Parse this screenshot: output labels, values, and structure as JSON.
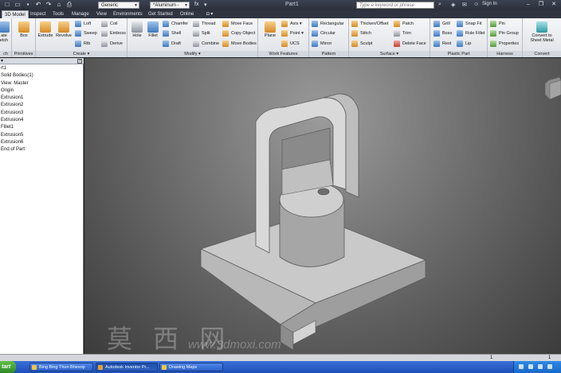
{
  "app": {
    "doc_title": "Part1",
    "help_search_placeholder": "Type a keyword or phrase",
    "sign_in": "Sign In",
    "qat_icons": [
      "new-icon",
      "open-icon",
      "save-icon",
      "undo-icon",
      "redo-icon",
      "home-icon",
      "print-icon"
    ],
    "appearance_combo": "Generic",
    "material_combo": "*Aluminum -"
  },
  "tabs": [
    {
      "label": "3D Model",
      "active": true
    },
    {
      "label": "Inspect"
    },
    {
      "label": "Tools"
    },
    {
      "label": "Manage"
    },
    {
      "label": "View"
    },
    {
      "label": "Environments"
    },
    {
      "label": "Get Started"
    },
    {
      "label": "Online"
    }
  ],
  "ribbon": {
    "panels": {
      "sketch": "ch",
      "primitives": "Primitives",
      "create": "Create",
      "modify": "Modify",
      "work_features": "Work Features",
      "pattern": "Pattern",
      "surface": "Surface",
      "plastic_part": "Plastic Part",
      "harness": "Harness",
      "convert": "Convert"
    },
    "buttons": {
      "sketch_partial": "ate\netch",
      "box": "Box",
      "extrude": "Extrude",
      "revolve": "Revolve",
      "loft": "Loft",
      "sweep": "Sweep",
      "rib": "Rib",
      "coil": "Coil",
      "emboss": "Emboss",
      "derive": "Derive",
      "hole": "Hole",
      "fillet": "Fillet",
      "chamfer": "Chamfer",
      "shell": "Shell",
      "draft": "Draft",
      "thread": "Thread",
      "split": "Split",
      "combine": "Combine",
      "move_face": "Move Face",
      "copy_object": "Copy Object",
      "move_bodies": "Move Bodies",
      "plane": "Plane",
      "axis": "Axis",
      "point": "Point",
      "ucs": "UCS",
      "rectangular": "Rectangular",
      "circular": "Circular",
      "mirror": "Mirror",
      "thicken_offset": "Thicken/Offset",
      "stitch": "Stitch",
      "sculpt": "Sculpt",
      "patch": "Patch",
      "trim": "Trim",
      "delete_face": "Delete Face",
      "grill": "Grill",
      "boss": "Boss",
      "rest": "Rest",
      "snap_fit": "Snap Fit",
      "rule_fillet": "Rule Fillet",
      "lip": "Lip",
      "pin": "Pin",
      "pin_group": "Pin Group",
      "properties": "Properties",
      "convert_sheet_metal": "Convert to\nSheet Metal"
    }
  },
  "browser": {
    "tree": [
      "rt1",
      "Solid Bodies(1)",
      "View: Master",
      "Origin",
      "Extrusion1",
      "Extrusion2",
      "Extrusion3",
      "Extrusion4",
      "Fillet1",
      "Extrusion5",
      "Extrusion6",
      "End of Part"
    ]
  },
  "viewport": {
    "watermark_cn": "莫 西 网",
    "watermark_url": "www.3dmoxi.com",
    "status_left_num": "1",
    "status_right_num": "1"
  },
  "taskbar": {
    "start": "tart",
    "items": [
      {
        "label": "Bing Bing Thun Bhesop"
      },
      {
        "label": "Autodesk Inventor Pr..."
      },
      {
        "label": "Drawing Maps"
      }
    ]
  },
  "colors": {
    "ribbon_bg": "#e6e8ec",
    "titlebar_bg": "#2f3440",
    "viewport_bg": "#6e6e6e",
    "taskbar_bg": "#2a5fc0"
  }
}
